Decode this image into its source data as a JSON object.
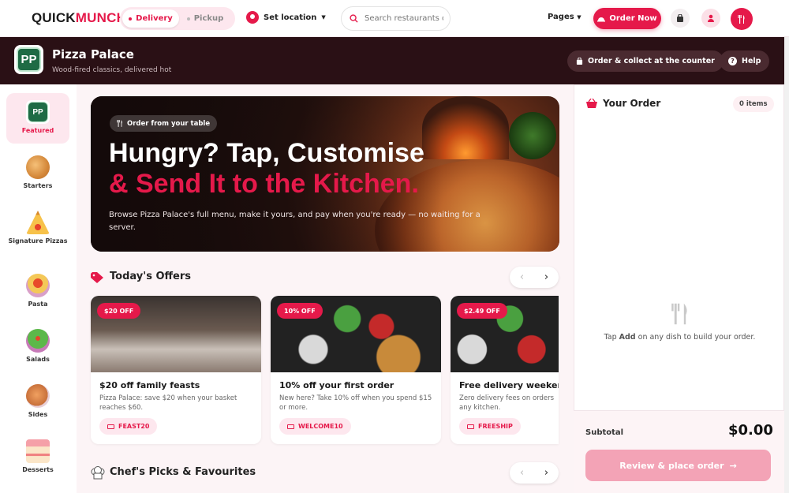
{
  "topbar": {
    "logo_main": "QUICK",
    "logo_accent": "MUNCH.",
    "mode_delivery": "Delivery",
    "mode_pickup": "Pickup",
    "location_label": "Set location",
    "search_placeholder": "Search restaurants o",
    "pages_label": "Pages",
    "order_now_label": "Order Now"
  },
  "restaurant": {
    "initials": "PP",
    "name": "Pizza Palace",
    "tagline": "Wood-fired classics, delivered hot",
    "order_collect_label": "Order & collect at the counter",
    "help_label": "Help"
  },
  "sidebar": {
    "items": [
      {
        "label": "Featured",
        "icon": "restaurant-logo-icon"
      },
      {
        "label": "Starters",
        "icon": "croissant-icon"
      },
      {
        "label": "Signature Pizzas",
        "icon": "pizza-slice-icon"
      },
      {
        "label": "Pasta",
        "icon": "pasta-bowl-icon"
      },
      {
        "label": "Salads",
        "icon": "salad-bowl-icon"
      },
      {
        "label": "Sides",
        "icon": "chicken-leg-icon"
      },
      {
        "label": "Desserts",
        "icon": "cake-slice-icon"
      }
    ]
  },
  "hero": {
    "pill": "Order from your table",
    "headline_1": "Hungry? Tap, Customise",
    "headline_2": "& Send It to the Kitchen.",
    "description": "Browse Pizza Palace's full menu, make it yours, and pay when you're ready — no waiting for a server."
  },
  "offers": {
    "title": "Today's Offers",
    "cards": [
      {
        "badge": "$20 OFF",
        "title": "$20 off family feasts",
        "desc": "Pizza Palace: save $20 when your basket reaches $60.",
        "code": "FEAST20"
      },
      {
        "badge": "10% OFF",
        "title": "10% off your first order",
        "desc": "New here? Take 10% off when you spend $15 or more.",
        "code": "WELCOME10"
      },
      {
        "badge": "$2.49 OFF",
        "title": "Free delivery weekends",
        "desc": "Zero delivery fees on orders any kitchen.",
        "code": "FREESHIP"
      }
    ]
  },
  "chefs_picks": {
    "title": "Chef's Picks & Favourites"
  },
  "cart": {
    "title": "Your Order",
    "count": "0 items",
    "empty_pre": "Tap ",
    "empty_bold": "Add",
    "empty_post": " on any dish to build your order.",
    "subtotal_label": "Subtotal",
    "subtotal_value": "$0.00",
    "review_label": "Review & place order"
  },
  "colors": {
    "accent": "#e5194a",
    "header_bg": "#2a1015"
  }
}
